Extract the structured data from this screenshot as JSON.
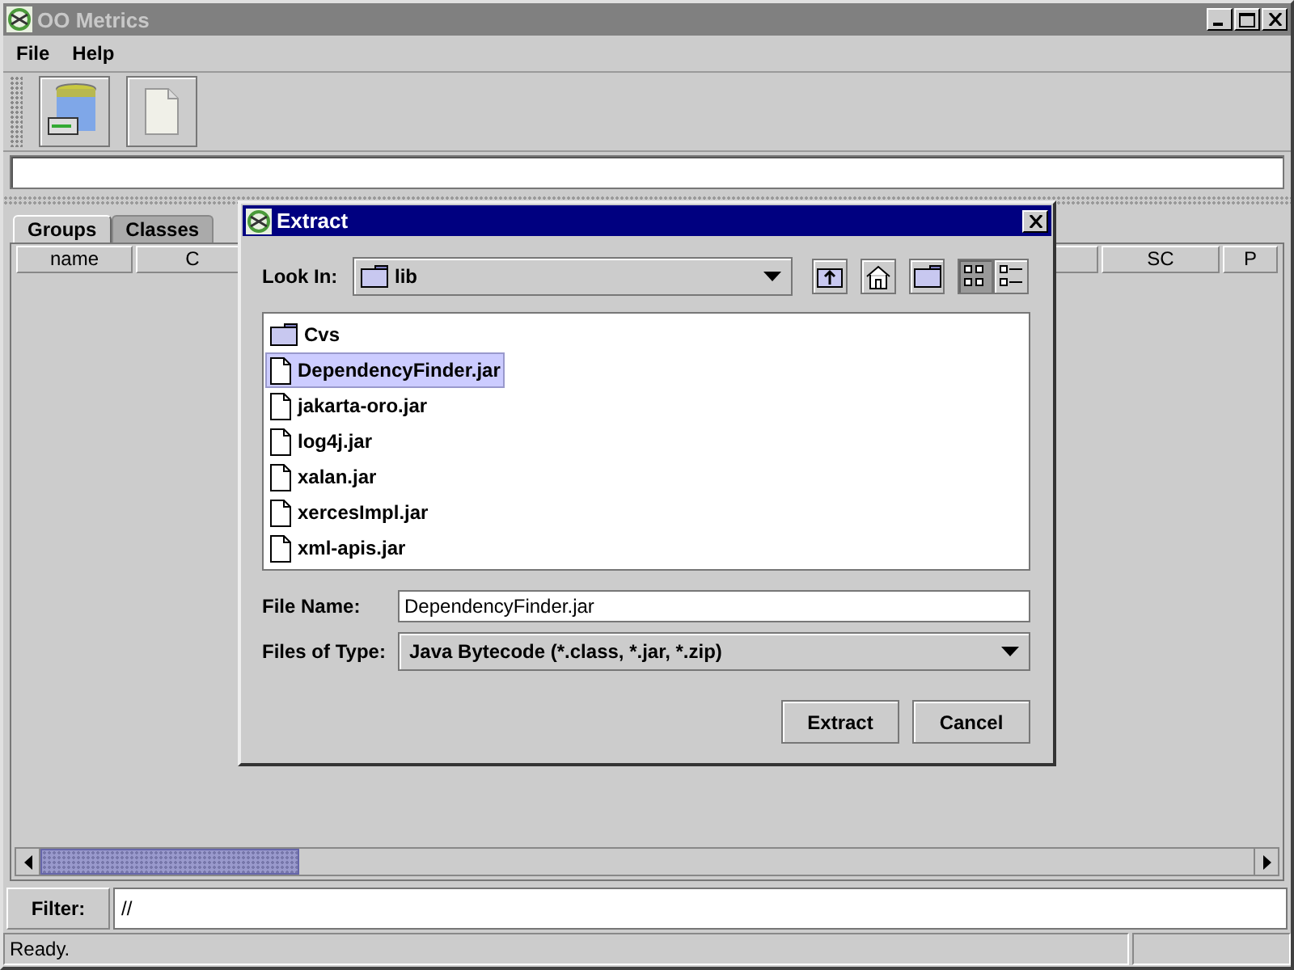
{
  "window": {
    "title": "OO Metrics"
  },
  "menu": [
    "File",
    "Help"
  ],
  "toolbar": [
    {
      "kind": "database"
    },
    {
      "kind": "document"
    }
  ],
  "tabs": [
    {
      "label": "Groups",
      "selected": true
    },
    {
      "label": "Classes",
      "selected": false
    }
  ],
  "table": {
    "columns_left": [
      "name",
      "C"
    ],
    "columns_right": [
      "SC",
      "P"
    ]
  },
  "filter": {
    "label": "Filter:",
    "value": "//"
  },
  "status_bar": "Ready.",
  "dialog": {
    "title": "Extract",
    "look_in_label": "Look In:",
    "look_in_value": "lib",
    "nav_buttons": [
      {
        "kind": "up",
        "selected": false
      },
      {
        "kind": "home",
        "selected": false
      },
      {
        "kind": "newfolder",
        "selected": false
      },
      {
        "kind": "list",
        "selected": true
      },
      {
        "kind": "details",
        "selected": false
      }
    ],
    "files": [
      {
        "name": "Cvs",
        "kind": "folder",
        "selected": false
      },
      {
        "name": "DependencyFinder.jar",
        "kind": "file",
        "selected": true
      },
      {
        "name": "jakarta-oro.jar",
        "kind": "file",
        "selected": false
      },
      {
        "name": "log4j.jar",
        "kind": "file",
        "selected": false
      },
      {
        "name": "xalan.jar",
        "kind": "file",
        "selected": false
      },
      {
        "name": "xercesImpl.jar",
        "kind": "file",
        "selected": false
      },
      {
        "name": "xml-apis.jar",
        "kind": "file",
        "selected": false
      }
    ],
    "file_name_label": "File Name:",
    "file_name_value": "DependencyFinder.jar",
    "type_label": "Files of Type:",
    "type_value": "Java Bytecode (*.class, *.jar, *.zip)",
    "buttons": [
      "Extract",
      "Cancel"
    ]
  }
}
